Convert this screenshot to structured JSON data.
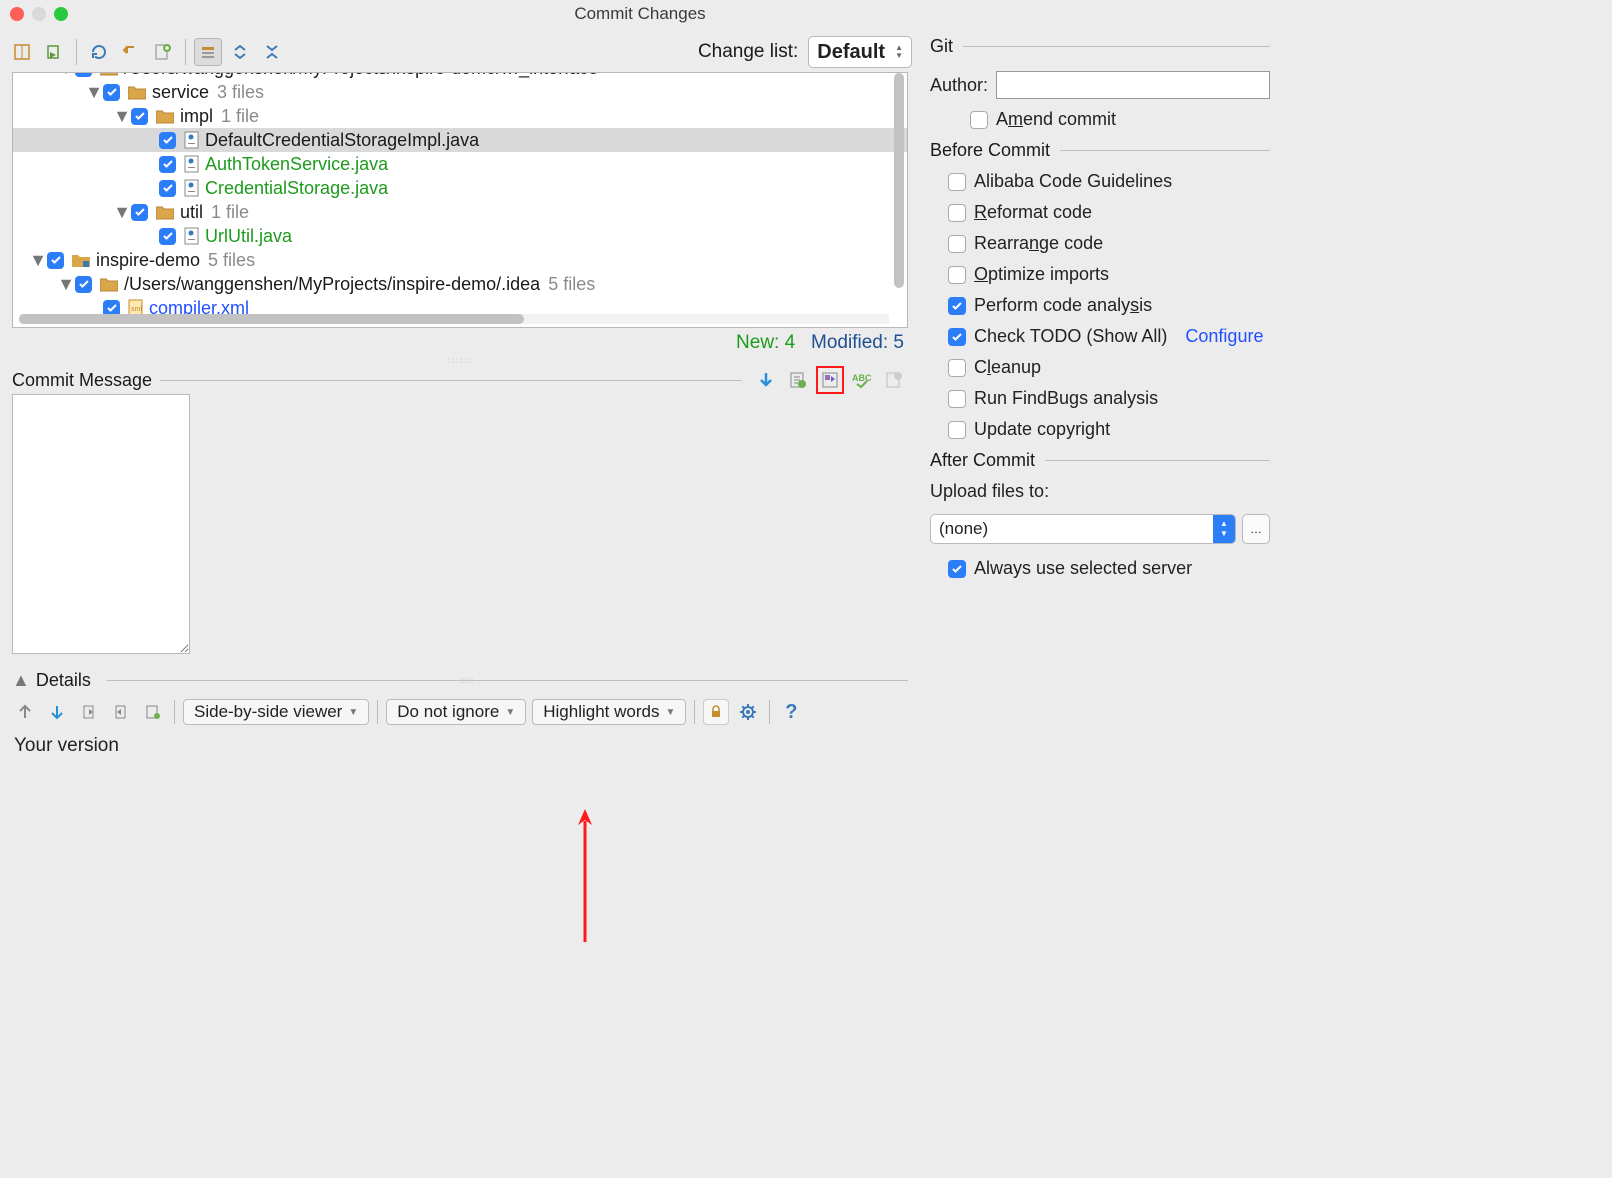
{
  "window": {
    "title": "Commit Changes"
  },
  "toolbar": {
    "change_list_label": "Change list:",
    "change_list_value": "Default"
  },
  "tree": {
    "root_path_fragment": "/Users/wanggenshen/MyProjects/inspire-demo/…_interface",
    "rows": [
      {
        "indent": 1,
        "expanded": true,
        "checked": true,
        "icon": "folder-mod",
        "name": "/Users/wanggenshen/MyProjects/inspire-demo/…_interface",
        "color": "black",
        "count": ""
      },
      {
        "indent": 2,
        "expanded": true,
        "checked": true,
        "icon": "folder",
        "name": "service",
        "color": "black",
        "count": "3 files"
      },
      {
        "indent": 3,
        "expanded": true,
        "checked": true,
        "icon": "folder",
        "name": "impl",
        "color": "black",
        "count": "1 file"
      },
      {
        "indent": 4,
        "expanded": null,
        "checked": true,
        "icon": "java",
        "name": "DefaultCredentialStorageImpl.java",
        "color": "black",
        "selected": true
      },
      {
        "indent": 4,
        "expanded": null,
        "checked": true,
        "icon": "java",
        "name": "AuthTokenService.java",
        "color": "green"
      },
      {
        "indent": 4,
        "expanded": null,
        "checked": true,
        "icon": "java",
        "name": "CredentialStorage.java",
        "color": "green"
      },
      {
        "indent": 3,
        "expanded": true,
        "checked": true,
        "icon": "folder",
        "name": "util",
        "color": "black",
        "count": "1 file"
      },
      {
        "indent": 4,
        "expanded": null,
        "checked": true,
        "icon": "java",
        "name": "UrlUtil.java",
        "color": "green"
      },
      {
        "indent": 0,
        "expanded": true,
        "checked": true,
        "icon": "module",
        "name": "inspire-demo",
        "color": "black",
        "count": "5 files"
      },
      {
        "indent": 1,
        "expanded": true,
        "checked": true,
        "icon": "folder-src",
        "name": "/Users/wanggenshen/MyProjects/inspire-demo/.idea",
        "color": "black",
        "count": "5 files"
      },
      {
        "indent": 2,
        "expanded": null,
        "checked": true,
        "icon": "xml",
        "name": "compiler.xml",
        "color": "blue"
      }
    ]
  },
  "status": {
    "new_label": "New:",
    "new_count": 4,
    "modified_label": "Modified:",
    "modified_count": 5
  },
  "commit_message": {
    "label": "Commit Message"
  },
  "details": {
    "label": "Details"
  },
  "bottom_bar": {
    "viewer_mode": "Side-by-side viewer",
    "ignore_mode": "Do not ignore",
    "highlight_mode": "Highlight words"
  },
  "your_version_label": "Your version",
  "git": {
    "section": "Git",
    "author_label": "Author:",
    "amend_label": "Amend commit",
    "before_commit": {
      "section": "Before Commit",
      "alibaba": "Alibaba Code Guidelines",
      "reformat": "Reformat code",
      "rearrange": "Rearrange code",
      "optimize": "Optimize imports",
      "analysis": "Perform code analysis",
      "todo": "Check TODO (Show All)",
      "configure": "Configure",
      "cleanup": "Cleanup",
      "findbugs": "Run FindBugs analysis",
      "copyright": "Update copyright"
    },
    "after_commit": {
      "section": "After Commit",
      "upload_label": "Upload files to:",
      "upload_value": "(none)",
      "always": "Always use selected server"
    }
  }
}
